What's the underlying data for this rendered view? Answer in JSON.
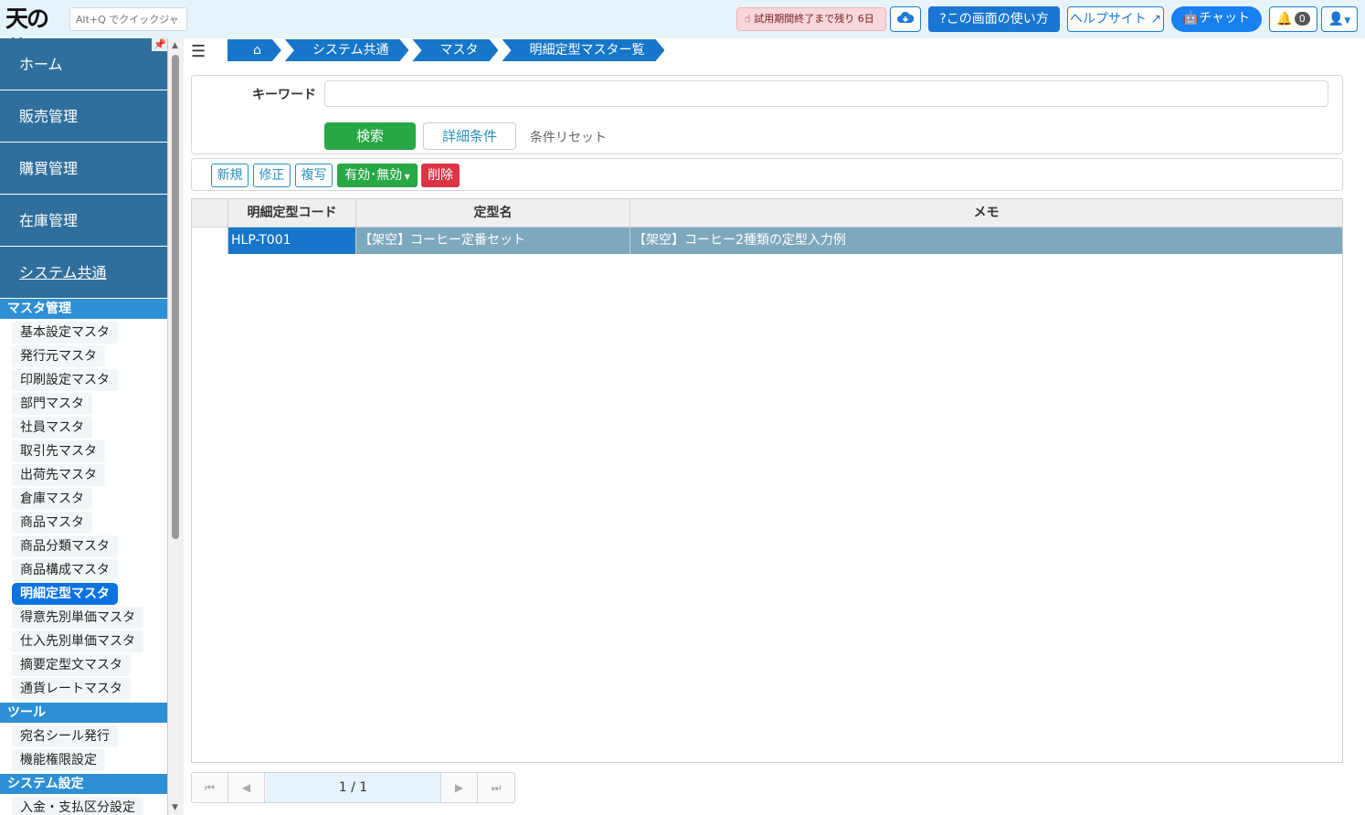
{
  "header": {
    "logo": "天の蔵",
    "quick_jump_placeholder": "Alt+Q でクイックジャンプ",
    "trial_notice": "試用期間終了まで残り 6日",
    "how_to_use": "?この画面の使い方",
    "help_site": "ヘルプサイト",
    "chat": "チャット",
    "notification_count": "0"
  },
  "sidebar": {
    "main_nav": [
      "ホーム",
      "販売管理",
      "購買管理",
      "在庫管理",
      "システム共通"
    ],
    "sections": [
      {
        "title": "マスタ管理",
        "items": [
          "基本設定マスタ",
          "発行元マスタ",
          "印刷設定マスタ",
          "部門マスタ",
          "社員マスタ",
          "取引先マスタ",
          "出荷先マスタ",
          "倉庫マスタ",
          "商品マスタ",
          "商品分類マスタ",
          "商品構成マスタ",
          "明細定型マスタ",
          "得意先別単価マスタ",
          "仕入先別単価マスタ",
          "摘要定型文マスタ",
          "通貨レートマスタ"
        ]
      },
      {
        "title": "ツール",
        "items": [
          "宛名シール発行",
          "機能権限設定"
        ]
      },
      {
        "title": "システム設定",
        "items": [
          "入金・支払区分設定"
        ]
      }
    ],
    "active_item": "明細定型マスタ"
  },
  "breadcrumb": [
    "システム共通",
    "マスタ",
    "明細定型マスター覧"
  ],
  "search": {
    "keyword_label": "キーワード",
    "keyword_value": "",
    "search_button": "検索",
    "detail_button": "詳細条件",
    "reset_link": "条件リセット"
  },
  "toolbar": {
    "new": "新規",
    "edit": "修正",
    "copy": "複写",
    "toggle": "有効･無効",
    "delete": "削除"
  },
  "table": {
    "columns": [
      "明細定型コード",
      "定型名",
      "メモ"
    ],
    "rows": [
      [
        "HLP-T001",
        "【架空】コーヒー定番セット",
        "【架空】コーヒー2種類の定型入力例"
      ]
    ]
  },
  "pager": {
    "page": "1 / 1"
  }
}
